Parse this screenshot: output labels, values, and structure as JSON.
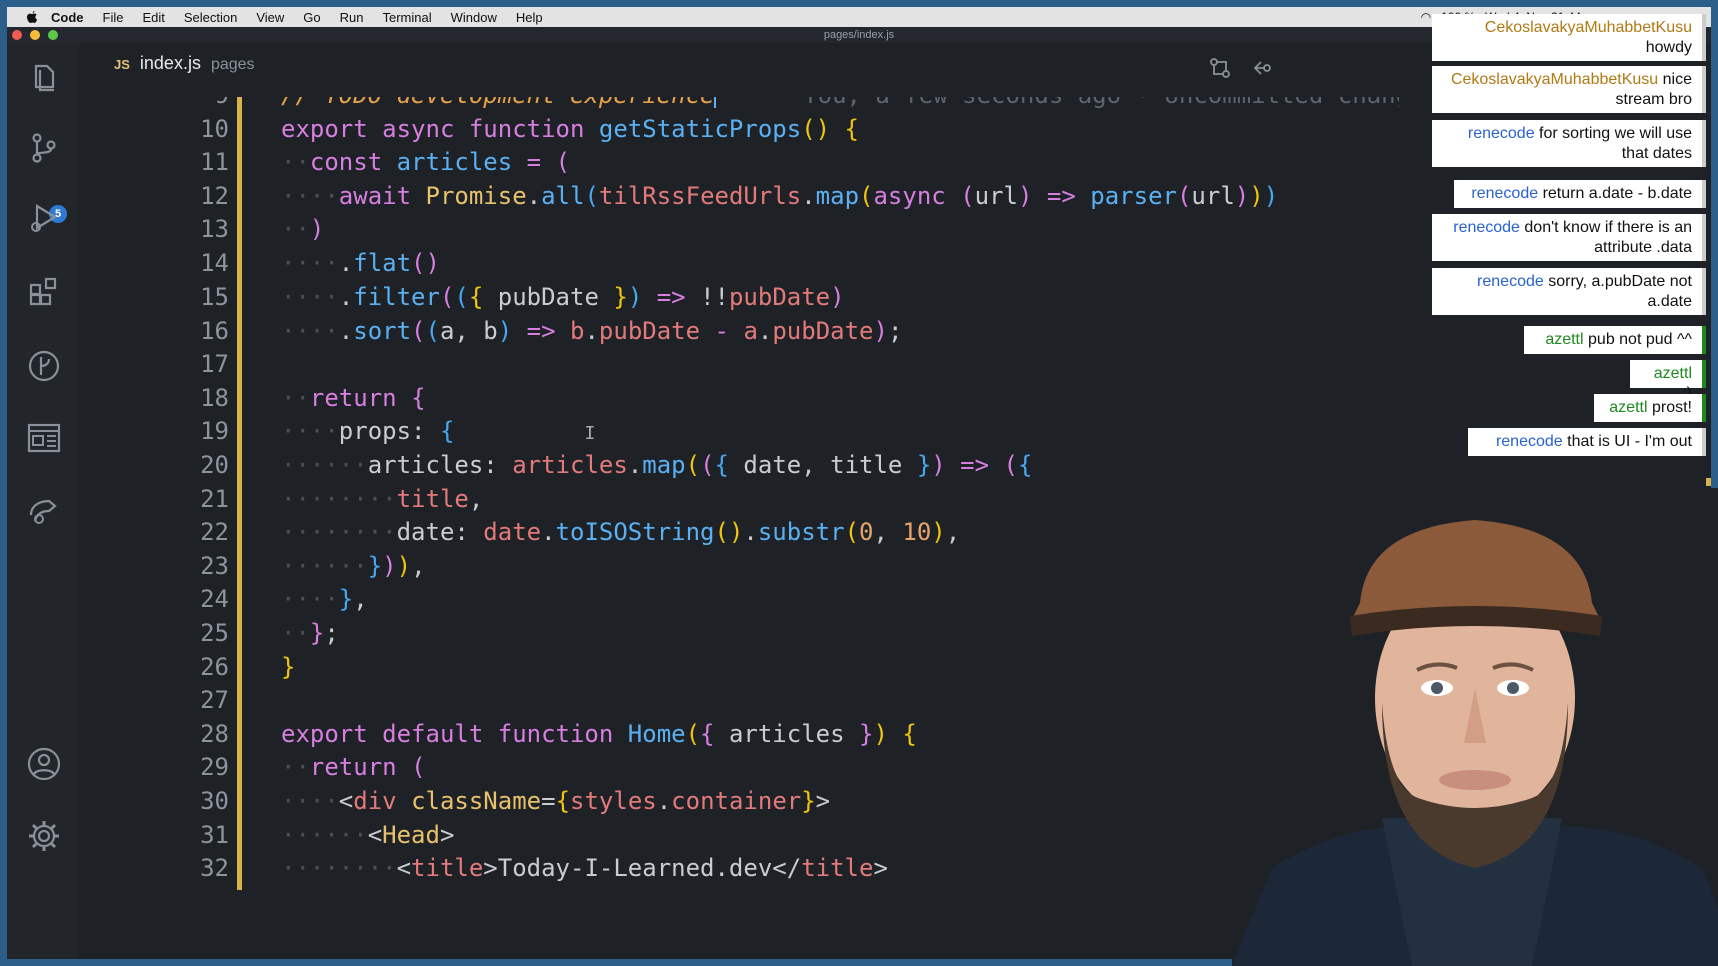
{
  "menubar": {
    "app": "Code",
    "items": [
      "File",
      "Edit",
      "Selection",
      "View",
      "Go",
      "Run",
      "Terminal",
      "Window",
      "Help"
    ],
    "status": "100 %",
    "datetime": "Wed 4. Nov 21:44"
  },
  "window": {
    "title": "pages/index.js"
  },
  "tab": {
    "lang": "JS",
    "filename": "index.js",
    "dir": "pages"
  },
  "scm_badge": "5",
  "blame": "You, a few seconds ago • Uncommitted change",
  "code_lines": [
    {
      "n": "9"
    },
    {
      "n": "10"
    },
    {
      "n": "11"
    },
    {
      "n": "12"
    },
    {
      "n": "13"
    },
    {
      "n": "14"
    },
    {
      "n": "15"
    },
    {
      "n": "16"
    },
    {
      "n": "17"
    },
    {
      "n": "18"
    },
    {
      "n": "19"
    },
    {
      "n": "20"
    },
    {
      "n": "21"
    },
    {
      "n": "22"
    },
    {
      "n": "23"
    },
    {
      "n": "24"
    },
    {
      "n": "25"
    },
    {
      "n": "26"
    },
    {
      "n": "27"
    },
    {
      "n": "28"
    },
    {
      "n": "29"
    },
    {
      "n": "30"
    },
    {
      "n": "31"
    },
    {
      "n": "32"
    }
  ],
  "chat": [
    {
      "user": "CekoslavakyaMuhabbetKusu",
      "text": "howdy"
    },
    {
      "user": "CekoslavakyaMuhabbetKusu",
      "text": "nice stream bro"
    },
    {
      "user": "renecode",
      "text": "for sorting we will use that dates"
    },
    {
      "user": "renecode",
      "text": "return a.date - b.date"
    },
    {
      "user": "renecode",
      "text": "don't know if there is an attribute .data"
    },
    {
      "user": "renecode",
      "text": "sorry, a.pubDate not a.date"
    },
    {
      "user": "azettl",
      "text": "pub not pud ^^"
    },
    {
      "user": "azettl",
      "text": ";)"
    },
    {
      "user": "azettl",
      "text": "prost!"
    },
    {
      "user": "renecode",
      "text": "that is UI - I'm out"
    }
  ],
  "colors": {
    "accent": "#2f7ad3",
    "gutter_modified": "#d8b24a",
    "frame": "#2b5f8a"
  }
}
